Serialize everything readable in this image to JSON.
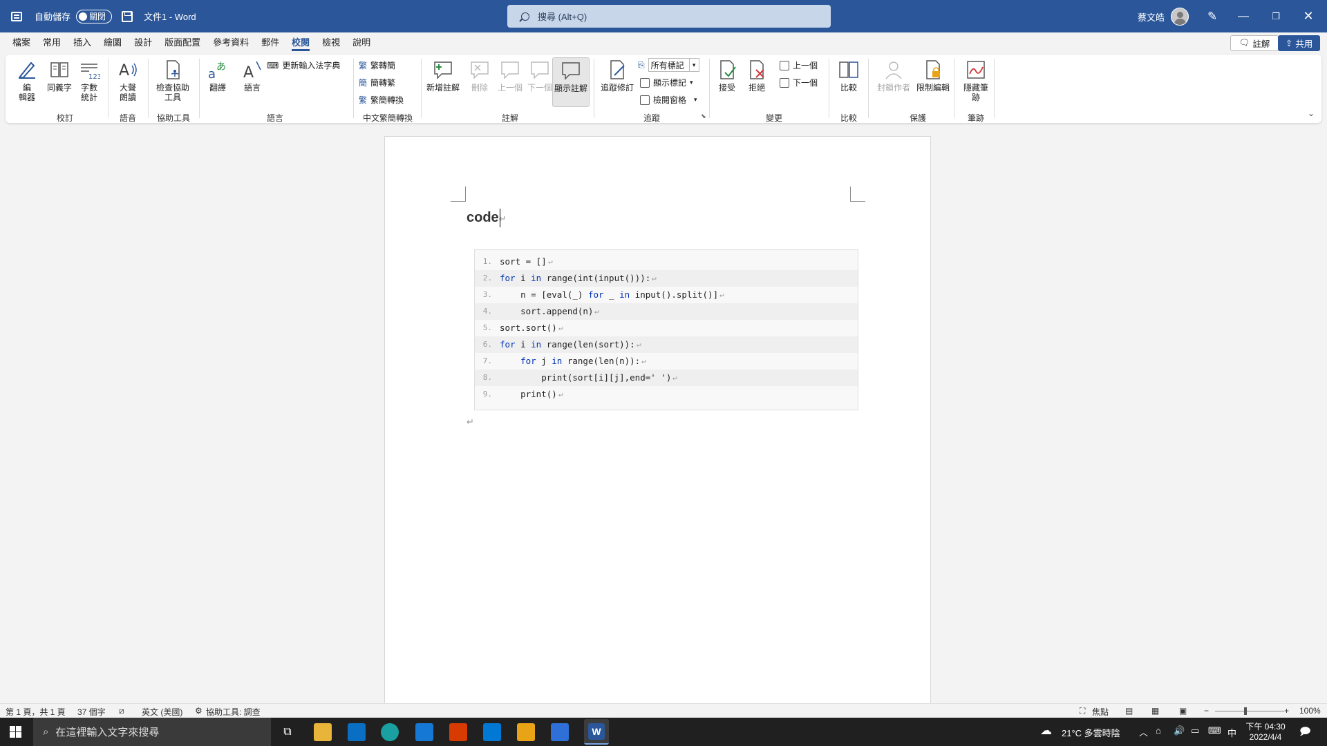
{
  "titlebar": {
    "autosave_label": "自動儲存",
    "autosave_state": "關閉",
    "doc_title": "文件1 - Word",
    "search_placeholder": "搜尋 (Alt+Q)",
    "user_name": "蔡文皓"
  },
  "menu": {
    "items": [
      "檔案",
      "常用",
      "插入",
      "繪圖",
      "設計",
      "版面配置",
      "參考資料",
      "郵件",
      "校閱",
      "檢視",
      "說明"
    ],
    "active": "校閱",
    "comment_button": "註解",
    "share_button": "共用"
  },
  "ribbon": {
    "proofing": {
      "editor": "編\n輯器",
      "thesaurus": "同義字",
      "word_count": "字數\n統計",
      "group": "校訂"
    },
    "speech": {
      "read_aloud": "大聲\n朗讀",
      "group": "語音"
    },
    "accessibility": {
      "check": "檢查協助\n工具",
      "group": "協助工具"
    },
    "language": {
      "translate": "翻譯",
      "language": "語言",
      "update_ime": "更新輸入法字典",
      "group": "語言"
    },
    "chinese_conversion": {
      "to_traditional": "繁轉簡",
      "to_simplified": "簡轉繁",
      "conversion": "繁簡轉換",
      "group": "中文繁簡轉換"
    },
    "comments": {
      "new": "新增註解",
      "delete": "刪除",
      "previous": "上一個",
      "next": "下一個",
      "show": "顯示註解",
      "group": "註解"
    },
    "tracking": {
      "track_changes": "追蹤修訂",
      "all_markup": "所有標記",
      "show_markup": "顯示標記",
      "reviewing_pane": "檢閱窗格",
      "group": "追蹤"
    },
    "changes": {
      "accept": "接受",
      "reject": "拒絕",
      "previous": "上一個",
      "next": "下一個",
      "group": "變更"
    },
    "compare": {
      "compare": "比較",
      "group": "比較"
    },
    "protect": {
      "block_authors": "封鎖作者",
      "restrict": "限制編輯",
      "group": "保護"
    },
    "ink": {
      "hide_ink": "隱藏筆\n跡",
      "group": "筆跡"
    }
  },
  "document": {
    "heading": "code",
    "code_lines": [
      "sort = []",
      "for i in range(int(input())):",
      "    n = [eval(_) for _ in input().split()]",
      "    sort.append(n)",
      "sort.sort()",
      "for i in range(len(sort)):",
      "    for j in range(len(n)):",
      "        print(sort[i][j],end=' ')",
      "    print()"
    ],
    "line_numbers": [
      "1.",
      "2.",
      "3.",
      "4.",
      "5.",
      "6.",
      "7.",
      "8.",
      "9."
    ],
    "paragraph_mark": "↵"
  },
  "status": {
    "page": "第 1 頁，共 1 頁",
    "words": "37 個字",
    "language": "英文 (美國)",
    "accessibility": "協助工具: 調查",
    "focus": "焦點",
    "zoom": "100%"
  },
  "taskbar": {
    "search_placeholder": "在這裡輸入文字來搜尋",
    "weather": "21°C 多雲時陰",
    "ime": "中",
    "time": "下午 04:30",
    "date": "2022/4/4"
  },
  "colors": {
    "word_blue": "#2b579a",
    "keyword": "#0033b3",
    "taskbar": "#202020"
  }
}
